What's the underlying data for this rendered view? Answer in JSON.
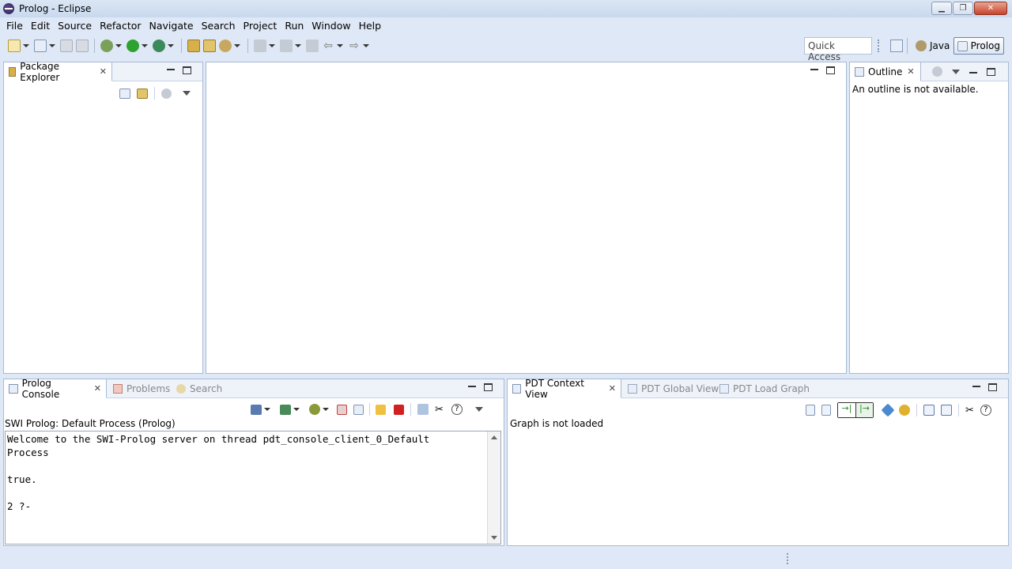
{
  "window": {
    "title": "Prolog - Eclipse"
  },
  "menu": [
    "File",
    "Edit",
    "Source",
    "Refactor",
    "Navigate",
    "Search",
    "Project",
    "Run",
    "Window",
    "Help"
  ],
  "toolbar": {
    "quick_access": "Quick Access",
    "perspectives": {
      "java": "Java",
      "prolog": "Prolog"
    }
  },
  "package_explorer": {
    "tab": "Package Explorer"
  },
  "outline": {
    "tab": "Outline",
    "message": "An outline is not available."
  },
  "console_panel": {
    "tabs": {
      "console": "Prolog Console",
      "problems": "Problems",
      "search": "Search"
    },
    "process_label": "SWI Prolog: Default Process (Prolog)",
    "text": "Welcome to the SWI-Prolog server on thread pdt_console_client_0_Default\nProcess\n\ntrue.\n\n2 ?-"
  },
  "pdt_panel": {
    "tabs": {
      "context": "PDT Context View",
      "global": "PDT Global View",
      "load": "PDT Load Graph"
    },
    "message": "Graph is not loaded"
  },
  "colors": {
    "accent": "#6d83aa",
    "background": "#dfe8f6",
    "run_green": "#2ea22e",
    "stop_red": "#d02020"
  }
}
